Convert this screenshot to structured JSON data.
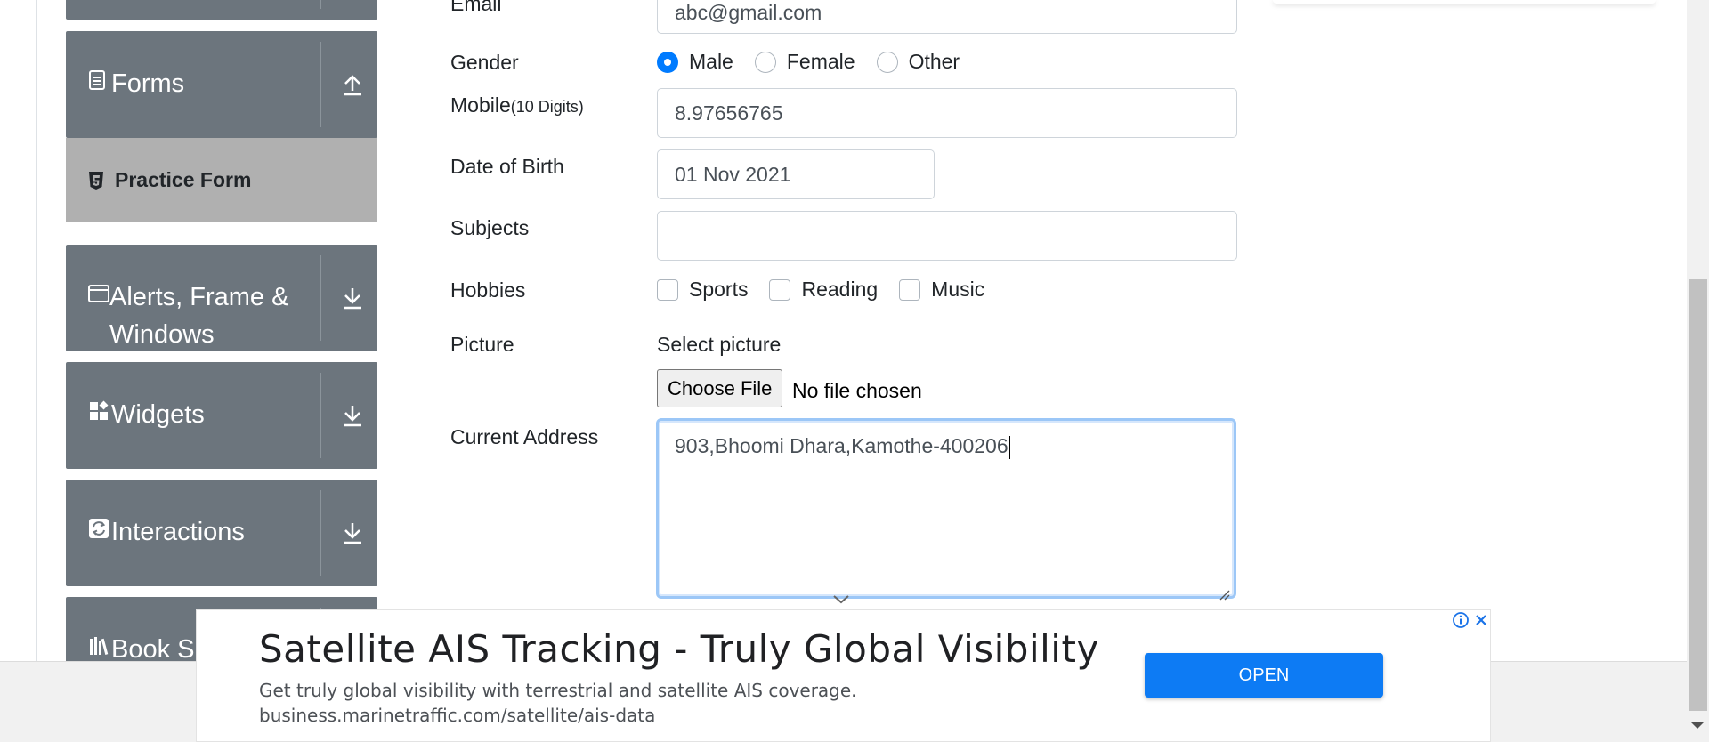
{
  "sidebar": {
    "groups": [
      {
        "label": "Forms",
        "icon": "document-icon",
        "toggle": "arrow-up"
      },
      {
        "label": "Alerts, Frame & Windows",
        "icon": "window-icon",
        "toggle": "arrow-down"
      },
      {
        "label": "Widgets",
        "icon": "widgets-icon",
        "toggle": "arrow-down"
      },
      {
        "label": "Interactions",
        "icon": "interactions-icon",
        "toggle": "arrow-down"
      },
      {
        "label": "Book S",
        "icon": "book-icon",
        "toggle": "arrow-down"
      }
    ],
    "active_item": {
      "label": "Practice Form",
      "icon": "html5-icon"
    }
  },
  "form": {
    "email": {
      "label": "Email",
      "value": "abc@gmail.com"
    },
    "gender": {
      "label": "Gender",
      "options": [
        "Male",
        "Female",
        "Other"
      ],
      "selected": "Male"
    },
    "mobile": {
      "label": "Mobile",
      "hint": "(10 Digits)",
      "value": "8.97656765"
    },
    "dob": {
      "label": "Date of Birth",
      "value": "01 Nov 2021"
    },
    "subjects": {
      "label": "Subjects",
      "value": ""
    },
    "hobbies": {
      "label": "Hobbies",
      "options": [
        "Sports",
        "Reading",
        "Music"
      ],
      "checked": []
    },
    "picture": {
      "label": "Picture",
      "caption": "Select picture",
      "button": "Choose File",
      "status": "No file chosen"
    },
    "address": {
      "label": "Current Address",
      "value": "903,Bhoomi Dhara,Kamothe-400206"
    }
  },
  "ad": {
    "headline": "Satellite AIS Tracking - Truly Global Visibility",
    "description": "Get truly global visibility with terrestrial and satellite AIS coverage.",
    "url": "business.marinetraffic.com/satellite/ais-data",
    "button": "OPEN",
    "accent": "#0d7bf4"
  },
  "colors": {
    "sidebar_bg": "#6c757d",
    "active_item_bg": "#b0b0b0",
    "radio_checked": "#007bff"
  }
}
